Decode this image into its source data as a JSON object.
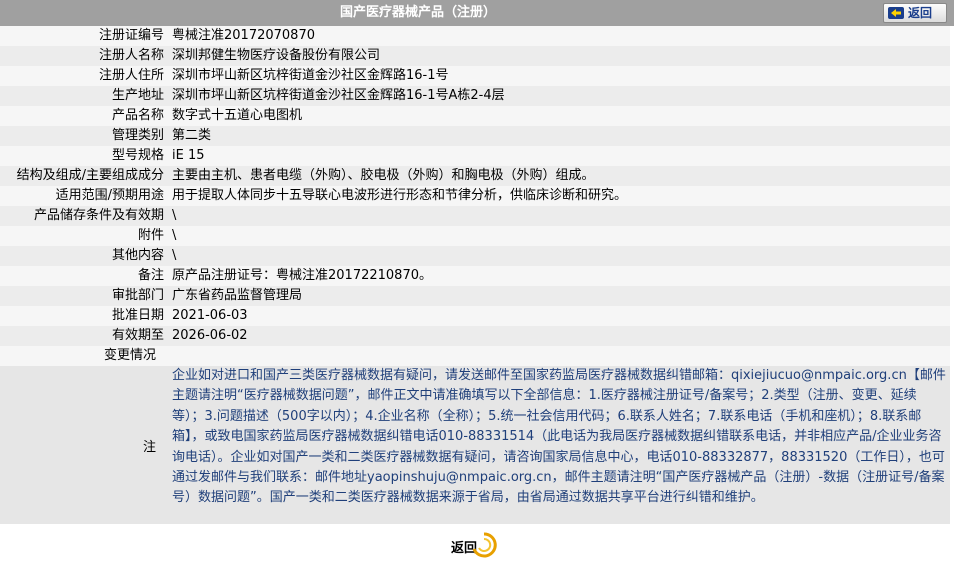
{
  "header": {
    "title": "国产医疗器械产品（注册）",
    "back_label": "返回"
  },
  "rows": [
    {
      "label": "注册证编号",
      "value": "粤械注准20172070870"
    },
    {
      "label": "注册人名称",
      "value": "深圳邦健生物医疗设备股份有限公司"
    },
    {
      "label": "注册人住所",
      "value": "深圳市坪山新区坑梓街道金沙社区金辉路16-1号"
    },
    {
      "label": "生产地址",
      "value": "深圳市坪山新区坑梓街道金沙社区金辉路16-1号A栋2-4层"
    },
    {
      "label": "产品名称",
      "value": "数字式十五道心电图机"
    },
    {
      "label": "管理类别",
      "value": "第二类"
    },
    {
      "label": "型号规格",
      "value": "iE 15"
    },
    {
      "label": "结构及组成/主要组成成分",
      "value": "主要由主机、患者电缆（外购）、胶电极（外购）和胸电极（外购）组成。"
    },
    {
      "label": "适用范围/预期用途",
      "value": "用于提取人体同步十五导联心电波形进行形态和节律分析，供临床诊断和研究。"
    },
    {
      "label": "产品储存条件及有效期",
      "value": "\\"
    },
    {
      "label": "附件",
      "value": "\\"
    },
    {
      "label": "其他内容",
      "value": "\\"
    },
    {
      "label": "备注",
      "value": "原产品注册证号：粤械注准20172210870。"
    },
    {
      "label": "审批部门",
      "value": "广东省药品监督管理局"
    },
    {
      "label": "批准日期",
      "value": "2021-06-03"
    },
    {
      "label": "有效期至",
      "value": "2026-06-02"
    }
  ],
  "change": {
    "label": "变更情况",
    "value": ""
  },
  "note": {
    "label": "注",
    "text": "企业如对进口和国产三类医疗器械数据有疑问，请发送邮件至国家药监局医疗器械数据纠错邮箱：qixiejiucuo@nmpaic.org.cn【邮件主题请注明“医疗器械数据问题”，邮件正文中请准确填写以下全部信息：1.医疗器械注册证号/备案号；2.类型（注册、变更、延续等）；3.问题描述（500字以内）；4.企业名称（全称）；5.统一社会信用代码；6.联系人姓名；7.联系电话（手机和座机）；8.联系邮箱】，或致电国家药监局医疗器械数据纠错电话010-88331514（此电话为我局医疗器械数据纠错联系电话，并非相应产品/企业业务咨询电话）。企业如对国产一类和二类医疗器械数据有疑问，请咨询国家局信息中心，电话010-88332877，88331520（工作日），也可通过发邮件与我们联系：邮件地址yaopinshuju@nmpaic.org.cn，邮件主题请注明“国产医疗器械产品（注册）-数据（注册证号/备案号）数据问题”。国产一类和二类医疗器械数据来源于省局，由省局通过数据共享平台进行纠错和维护。"
  },
  "footer": {
    "back_label": "返回"
  },
  "colors": {
    "header_bg": "#a0a0a0",
    "note_text": "#1f3f7a",
    "back_arrow": "#e8a000"
  }
}
